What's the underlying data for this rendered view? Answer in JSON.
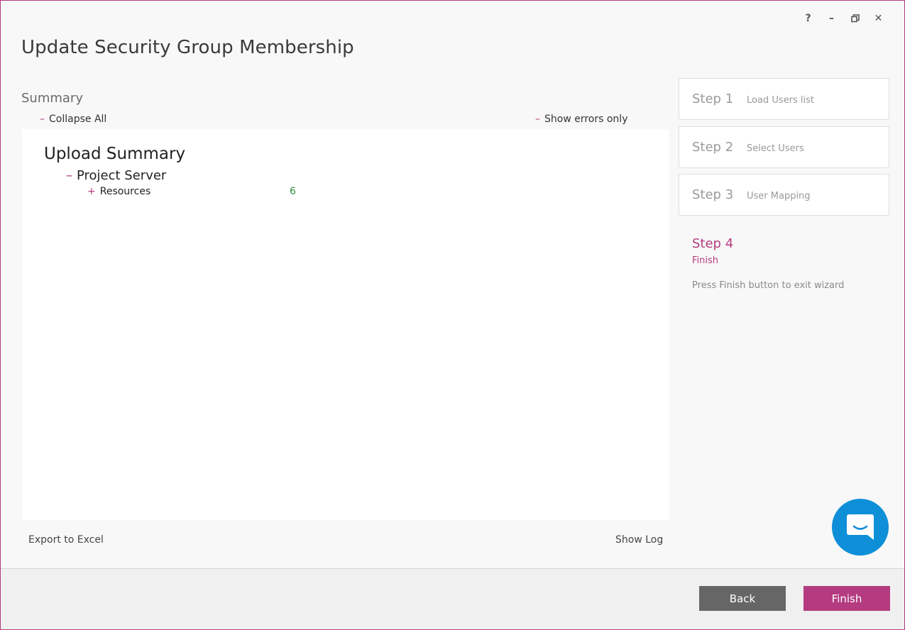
{
  "window": {
    "title": "Update Security Group Membership",
    "controls": {
      "help": "?",
      "minimize": "–",
      "restore": "🗗",
      "close": "✕"
    }
  },
  "summary": {
    "label": "Summary",
    "collapse_all": "Collapse All",
    "show_errors_only": "Show errors only",
    "collapse_icon": "–",
    "expand_icon": "+",
    "tree": {
      "root": "Upload Summary",
      "node": "Project Server",
      "child": {
        "label": "Resources",
        "value": "6"
      }
    },
    "export_label": "Export to Excel",
    "show_log_label": "Show Log"
  },
  "steps": [
    {
      "num": "Step 1",
      "name": "Load Users list"
    },
    {
      "num": "Step 2",
      "name": "Select Users"
    },
    {
      "num": "Step 3",
      "name": "User Mapping"
    }
  ],
  "active_step": {
    "num": "Step 4",
    "name": "Finish",
    "description": "Press Finish button to exit wizard"
  },
  "footer": {
    "back_label": "Back",
    "finish_label": "Finish"
  },
  "colors": {
    "accent": "#b43b80",
    "back_button": "#666666",
    "chat": "#0e8fd8",
    "value_green": "#2e8b3e"
  },
  "icons": {
    "chat": "chat-bubble-icon"
  }
}
